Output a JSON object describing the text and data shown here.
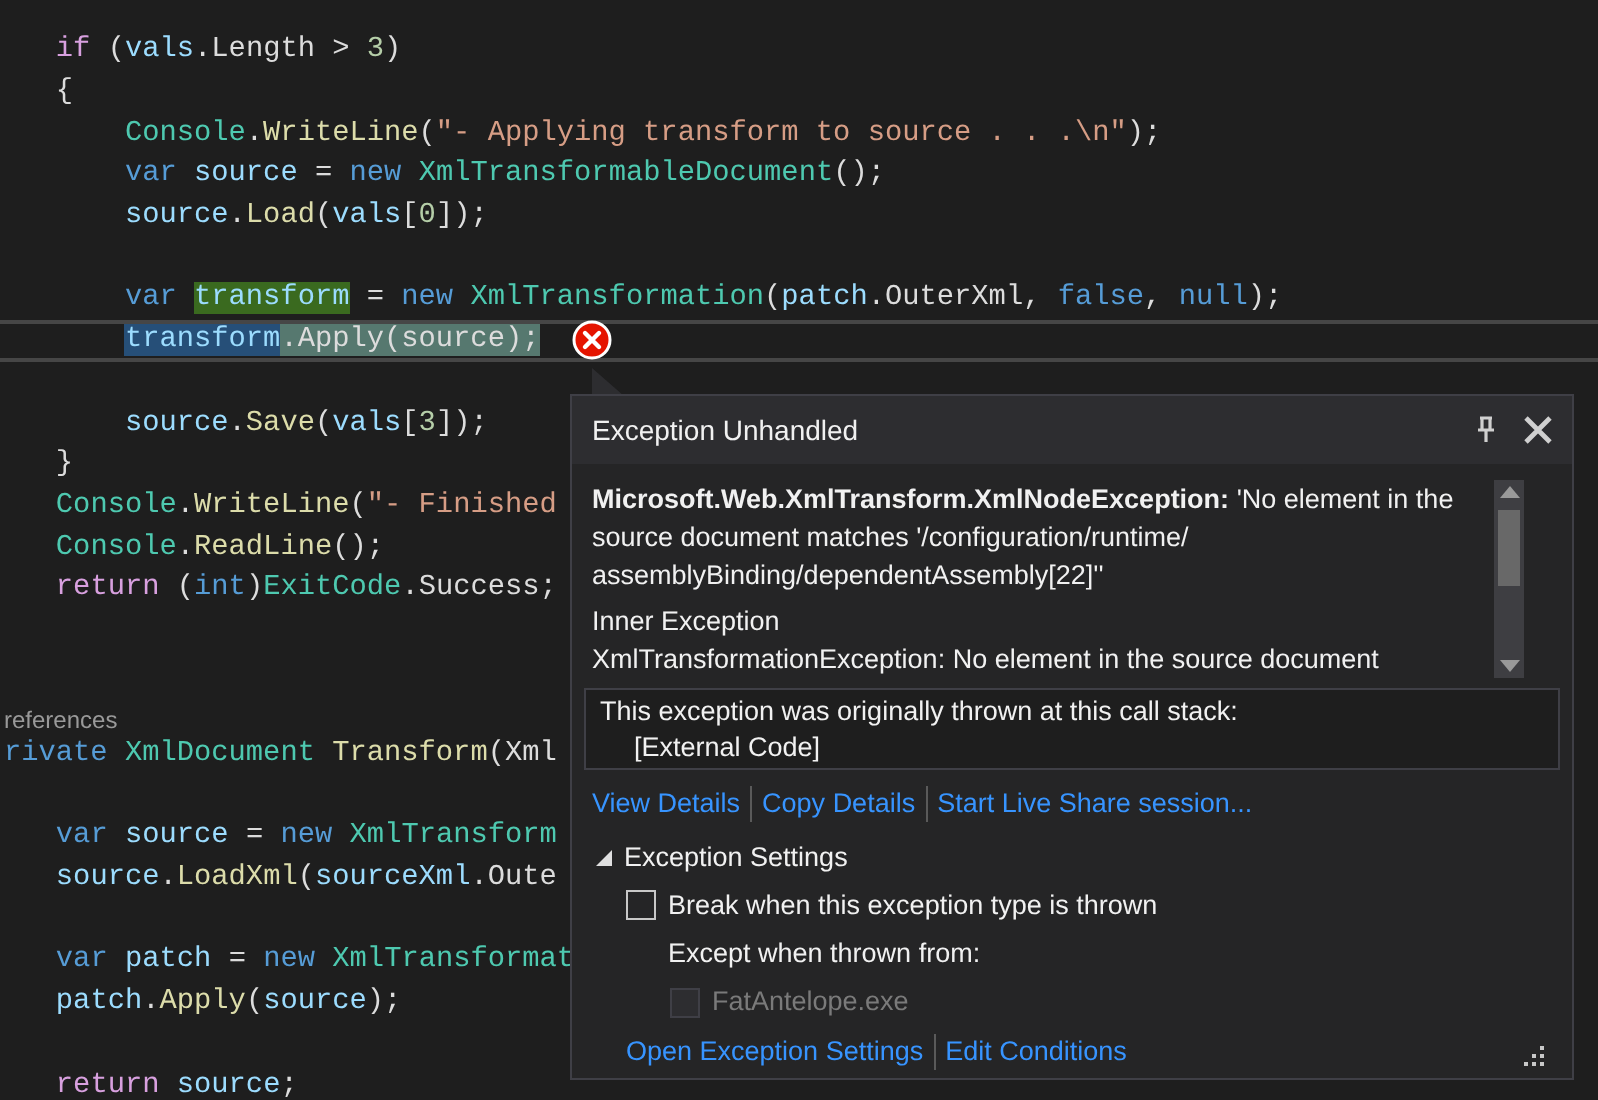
{
  "code_lines": [
    {
      "kind": "code",
      "tokens": [
        {
          "text": "   if",
          "kind": "ctl"
        },
        {
          "text": " (",
          "kind": "plain"
        },
        {
          "text": "vals",
          "kind": "var"
        },
        {
          "text": ".Length > ",
          "kind": "plain"
        },
        {
          "text": "3",
          "kind": "num"
        },
        {
          "text": ")",
          "kind": "plain"
        }
      ]
    },
    {
      "kind": "code",
      "tokens": [
        {
          "text": "   {",
          "kind": "plain"
        }
      ]
    },
    {
      "kind": "code",
      "tokens": [
        {
          "text": "       Console",
          "kind": "type"
        },
        {
          "text": ".",
          "kind": "plain"
        },
        {
          "text": "WriteLine",
          "kind": "fn"
        },
        {
          "text": "(",
          "kind": "plain"
        },
        {
          "text": "\"- Applying transform to source . . .\\n\"",
          "kind": "str"
        },
        {
          "text": ");",
          "kind": "plain"
        }
      ]
    },
    {
      "kind": "code",
      "tokens": [
        {
          "text": "       var",
          "kind": "kw"
        },
        {
          "text": " source",
          "kind": "var"
        },
        {
          "text": " = ",
          "kind": "plain"
        },
        {
          "text": "new",
          "kind": "kw"
        },
        {
          "text": " XmlTransformableDocument",
          "kind": "type"
        },
        {
          "text": "();",
          "kind": "plain"
        }
      ]
    },
    {
      "kind": "code",
      "tokens": [
        {
          "text": "       source",
          "kind": "var"
        },
        {
          "text": ".",
          "kind": "plain"
        },
        {
          "text": "Load",
          "kind": "fn"
        },
        {
          "text": "(",
          "kind": "plain"
        },
        {
          "text": "vals",
          "kind": "var"
        },
        {
          "text": "[",
          "kind": "plain"
        },
        {
          "text": "0",
          "kind": "num"
        },
        {
          "text": "]);",
          "kind": "plain"
        }
      ]
    },
    {
      "kind": "blank"
    },
    {
      "kind": "code",
      "tokens": [
        {
          "text": "       var ",
          "kind": "kw"
        },
        {
          "text": "transform",
          "kind": "var",
          "write_highlight": true
        },
        {
          "text": " = ",
          "kind": "plain"
        },
        {
          "text": "new",
          "kind": "kw"
        },
        {
          "text": " XmlTransformation",
          "kind": "type"
        },
        {
          "text": "(",
          "kind": "plain"
        },
        {
          "text": "patch",
          "kind": "var"
        },
        {
          "text": ".OuterXml, ",
          "kind": "plain"
        },
        {
          "text": "false",
          "kind": "kw"
        },
        {
          "text": ", ",
          "kind": "plain"
        },
        {
          "text": "null",
          "kind": "kw"
        },
        {
          "text": ");",
          "kind": "plain"
        }
      ]
    },
    {
      "kind": "code",
      "current": true,
      "error": true,
      "tokens": [
        {
          "text": "       transform",
          "kind": "var",
          "read_highlight": true
        },
        {
          "text": ".Apply(source);",
          "kind": "plain",
          "statement_highlight": true
        }
      ]
    },
    {
      "kind": "blank"
    },
    {
      "kind": "code",
      "tokens": [
        {
          "text": "       source",
          "kind": "var"
        },
        {
          "text": ".",
          "kind": "plain"
        },
        {
          "text": "Save",
          "kind": "fn"
        },
        {
          "text": "(",
          "kind": "plain"
        },
        {
          "text": "vals",
          "kind": "var"
        },
        {
          "text": "[",
          "kind": "plain"
        },
        {
          "text": "3",
          "kind": "num"
        },
        {
          "text": "]);",
          "kind": "plain"
        }
      ]
    },
    {
      "kind": "code",
      "tokens": [
        {
          "text": "   }",
          "kind": "plain"
        }
      ]
    },
    {
      "kind": "code",
      "tokens": [
        {
          "text": "   Console",
          "kind": "type"
        },
        {
          "text": ".",
          "kind": "plain"
        },
        {
          "text": "WriteLine",
          "kind": "fn"
        },
        {
          "text": "(",
          "kind": "plain"
        },
        {
          "text": "\"- Finished",
          "kind": "str"
        }
      ]
    },
    {
      "kind": "code",
      "tokens": [
        {
          "text": "   Console",
          "kind": "type"
        },
        {
          "text": ".",
          "kind": "plain"
        },
        {
          "text": "ReadLine",
          "kind": "fn"
        },
        {
          "text": "();",
          "kind": "plain"
        }
      ]
    },
    {
      "kind": "code",
      "tokens": [
        {
          "text": "   return",
          "kind": "ctl"
        },
        {
          "text": " (",
          "kind": "plain"
        },
        {
          "text": "int",
          "kind": "kw"
        },
        {
          "text": ")",
          "kind": "plain"
        },
        {
          "text": "ExitCode",
          "kind": "type"
        },
        {
          "text": ".Success;",
          "kind": "plain"
        }
      ]
    },
    {
      "kind": "blank"
    },
    {
      "kind": "blank"
    },
    {
      "kind": "codelens",
      "text": "references"
    },
    {
      "kind": "code",
      "tokens": [
        {
          "text": "rivate",
          "kind": "kw"
        },
        {
          "text": " XmlDocument",
          "kind": "type"
        },
        {
          "text": " Transform",
          "kind": "fn"
        },
        {
          "text": "(Xml",
          "kind": "plain"
        }
      ]
    },
    {
      "kind": "blank"
    },
    {
      "kind": "code",
      "tokens": [
        {
          "text": "   var",
          "kind": "kw"
        },
        {
          "text": " source",
          "kind": "var"
        },
        {
          "text": " = ",
          "kind": "plain"
        },
        {
          "text": "new",
          "kind": "kw"
        },
        {
          "text": " XmlTransform",
          "kind": "type"
        }
      ]
    },
    {
      "kind": "code",
      "tokens": [
        {
          "text": "   source",
          "kind": "var"
        },
        {
          "text": ".",
          "kind": "plain"
        },
        {
          "text": "LoadXml",
          "kind": "fn"
        },
        {
          "text": "(",
          "kind": "plain"
        },
        {
          "text": "sourceXml",
          "kind": "var"
        },
        {
          "text": ".Oute",
          "kind": "plain"
        }
      ]
    },
    {
      "kind": "blank"
    },
    {
      "kind": "code",
      "tokens": [
        {
          "text": "   var",
          "kind": "kw"
        },
        {
          "text": " patch",
          "kind": "var"
        },
        {
          "text": " = ",
          "kind": "plain"
        },
        {
          "text": "new",
          "kind": "kw"
        },
        {
          "text": " XmlTransformat",
          "kind": "type"
        }
      ]
    },
    {
      "kind": "code",
      "tokens": [
        {
          "text": "   patch",
          "kind": "var"
        },
        {
          "text": ".",
          "kind": "plain"
        },
        {
          "text": "Apply",
          "kind": "fn"
        },
        {
          "text": "(",
          "kind": "plain"
        },
        {
          "text": "source",
          "kind": "var"
        },
        {
          "text": ");",
          "kind": "plain"
        }
      ]
    },
    {
      "kind": "blank"
    },
    {
      "kind": "code",
      "tokens": [
        {
          "text": "   return",
          "kind": "ctl"
        },
        {
          "text": " source",
          "kind": "var"
        },
        {
          "text": ";",
          "kind": "plain"
        }
      ]
    }
  ],
  "exception_popup": {
    "title": "Exception Unhandled",
    "message": "**Microsoft.Web.XmlTransform.XmlNodeException:** 'No element in the source document matches '/configuration/runtime/ assemblyBinding/dependentAssembly[22]''",
    "inner_exception": {
      "heading": "Inner Exception",
      "text": "XmlTransformationException: No element in the source document"
    },
    "call_stack": {
      "heading": "This exception was originally thrown at this call stack:",
      "frames": [
        "[External Code]"
      ]
    },
    "links": [
      "View Details",
      "Copy Details",
      "Start Live Share session..."
    ],
    "settings": {
      "heading": "Exception Settings",
      "expanded": true,
      "break_option": {
        "label": "Break when this exception type is thrown",
        "checked": false
      },
      "except_label": "Except when thrown from:",
      "modules": [
        {
          "label": "FatAntelope.exe",
          "checked": false,
          "disabled": true
        }
      ],
      "links": [
        "Open Exception Settings",
        "Edit Conditions"
      ]
    }
  }
}
